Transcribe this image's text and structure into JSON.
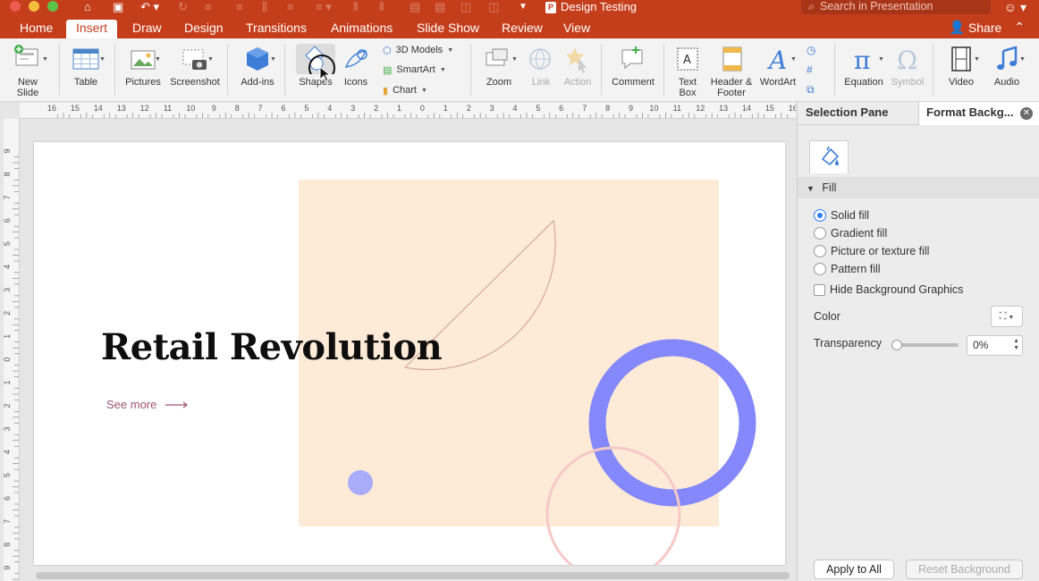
{
  "window": {
    "doc_title": "Design Testing",
    "search_placeholder": "Search in Presentation"
  },
  "tabs": [
    "Home",
    "Insert",
    "Draw",
    "Design",
    "Transitions",
    "Animations",
    "Slide Show",
    "Review",
    "View"
  ],
  "active_tab": "Insert",
  "share_label": "Share",
  "ribbon": {
    "new_slide": "New\nSlide",
    "table": "Table",
    "pictures": "Pictures",
    "screenshot": "Screenshot",
    "addins": "Add-ins",
    "shapes": "Shapes",
    "icons": "Icons",
    "models3d": "3D Models",
    "smartart": "SmartArt",
    "chart": "Chart",
    "zoom": "Zoom",
    "link": "Link",
    "action": "Action",
    "comment": "Comment",
    "text_box": "Text\nBox",
    "header_footer": "Header &\nFooter",
    "wordart": "WordArt",
    "equation": "Equation",
    "symbol": "Symbol",
    "video": "Video",
    "audio": "Audio"
  },
  "ruler": {
    "h_ticks": [
      "16",
      "15",
      "14",
      "13",
      "12",
      "11",
      "10",
      "9",
      "8",
      "7",
      "6",
      "5",
      "4",
      "3",
      "2",
      "1",
      "0",
      "1",
      "2",
      "3",
      "4",
      "5",
      "6",
      "7",
      "8",
      "9",
      "10",
      "11",
      "12",
      "13",
      "14",
      "15",
      "16"
    ],
    "v_ticks": [
      "9",
      "8",
      "7",
      "6",
      "5",
      "4",
      "3",
      "2",
      "1",
      "0",
      "1",
      "2",
      "3",
      "4",
      "5",
      "6",
      "7",
      "8",
      "9"
    ]
  },
  "slide": {
    "title": "Retail Revolution",
    "link_text": "See more",
    "colors": {
      "peach": "#fdebd7",
      "ring": "#8488fa",
      "dot": "#a8acf9",
      "arc_stroke": "#d09a94",
      "pink_ring": "#f6c9c6"
    }
  },
  "pane": {
    "tab_selection": "Selection Pane",
    "tab_format": "Format Backg...",
    "section_fill": "Fill",
    "options": [
      "Solid fill",
      "Gradient fill",
      "Picture or texture fill",
      "Pattern fill"
    ],
    "selected_option": "Solid fill",
    "hide_bg": "Hide Background Graphics",
    "color_label": "Color",
    "transparency_label": "Transparency",
    "transparency_value": "0%",
    "apply_all": "Apply to All",
    "reset_bg": "Reset Background"
  }
}
